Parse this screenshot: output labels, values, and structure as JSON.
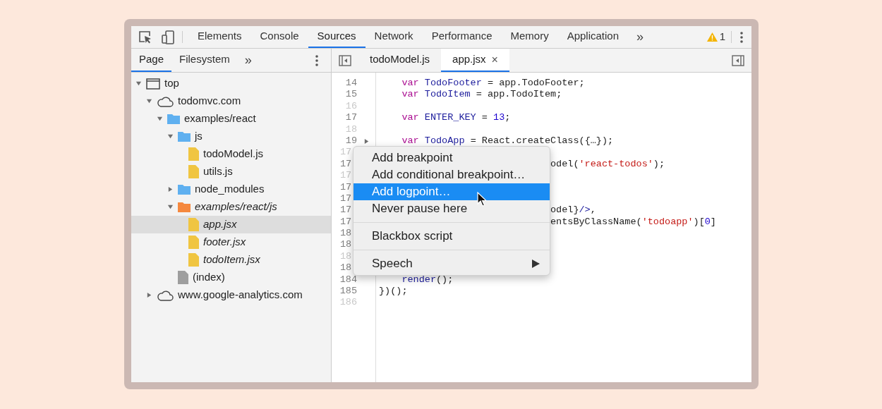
{
  "toolbar": {
    "tabs": [
      {
        "label": "Elements",
        "selected": false
      },
      {
        "label": "Console",
        "selected": false
      },
      {
        "label": "Sources",
        "selected": true
      },
      {
        "label": "Network",
        "selected": false
      },
      {
        "label": "Performance",
        "selected": false
      },
      {
        "label": "Memory",
        "selected": false
      },
      {
        "label": "Application",
        "selected": false
      }
    ],
    "more": "»",
    "warnings": "1"
  },
  "navigator": {
    "tabs": [
      {
        "label": "Page",
        "selected": true
      },
      {
        "label": "Filesystem",
        "selected": false
      }
    ],
    "more": "»",
    "tree": [
      {
        "label": "top",
        "kind": "frame",
        "expanded": true,
        "selected": false,
        "italic": false,
        "children": [
          {
            "label": "todomvc.com",
            "kind": "domain",
            "expanded": true,
            "selected": false,
            "italic": false,
            "children": [
              {
                "label": "examples/react",
                "kind": "folder",
                "color": "#5fb0f0",
                "expanded": true,
                "selected": false,
                "italic": false,
                "children": [
                  {
                    "label": "js",
                    "kind": "folder",
                    "color": "#5fb0f0",
                    "expanded": true,
                    "selected": false,
                    "italic": false,
                    "children": [
                      {
                        "label": "todoModel.js",
                        "kind": "file",
                        "color": "#f0c541",
                        "selected": false,
                        "italic": false
                      },
                      {
                        "label": "utils.js",
                        "kind": "file",
                        "color": "#f0c541",
                        "selected": false,
                        "italic": false
                      }
                    ]
                  },
                  {
                    "label": "node_modules",
                    "kind": "folder",
                    "color": "#5fb0f0",
                    "expanded": false,
                    "selected": false,
                    "italic": false
                  },
                  {
                    "label": "examples/react/js",
                    "kind": "folder",
                    "color": "#f5883e",
                    "expanded": true,
                    "selected": false,
                    "italic": true,
                    "children": [
                      {
                        "label": "app.jsx",
                        "kind": "file",
                        "color": "#f0c541",
                        "selected": true,
                        "italic": true
                      },
                      {
                        "label": "footer.jsx",
                        "kind": "file",
                        "color": "#f0c541",
                        "selected": false,
                        "italic": true
                      },
                      {
                        "label": "todoItem.jsx",
                        "kind": "file",
                        "color": "#f0c541",
                        "selected": false,
                        "italic": true
                      }
                    ]
                  },
                  {
                    "label": "(index)",
                    "kind": "file",
                    "color": "#9e9e9e",
                    "selected": false,
                    "italic": false
                  }
                ]
              }
            ]
          },
          {
            "label": "www.google-analytics.com",
            "kind": "domain",
            "expanded": false,
            "selected": false,
            "italic": false
          }
        ]
      }
    ]
  },
  "editor": {
    "tabs": [
      {
        "label": "todoModel.js",
        "selected": false,
        "closable": false
      },
      {
        "label": "app.jsx",
        "selected": true,
        "closable": true
      }
    ],
    "close": "×",
    "lines": [
      {
        "number": "14",
        "kind": "normal",
        "muted": false,
        "collapsed": false,
        "tokens": [
          {
            "text": "    var ",
            "kind": "keyword"
          },
          {
            "text": "TodoFooter",
            "kind": "variable"
          },
          {
            "text": " = app.TodoFooter;",
            "kind": "plain"
          }
        ]
      },
      {
        "number": "15",
        "kind": "normal",
        "muted": false,
        "collapsed": false,
        "tokens": [
          {
            "text": "    var ",
            "kind": "keyword"
          },
          {
            "text": "TodoItem",
            "kind": "variable"
          },
          {
            "text": " = app.TodoItem;",
            "kind": "plain"
          }
        ]
      },
      {
        "number": "16",
        "kind": "normal",
        "muted": true,
        "collapsed": false
      },
      {
        "number": "17",
        "kind": "normal",
        "muted": false,
        "collapsed": false,
        "tokens": [
          {
            "text": "    var ",
            "kind": "keyword"
          },
          {
            "text": "ENTER_KEY",
            "kind": "variable"
          },
          {
            "text": " = ",
            "kind": "plain"
          },
          {
            "text": "13",
            "kind": "number"
          },
          {
            "text": ";",
            "kind": "plain"
          }
        ]
      },
      {
        "number": "18",
        "kind": "normal",
        "muted": true,
        "collapsed": false
      },
      {
        "number": "19",
        "kind": "normal",
        "muted": false,
        "collapsed": true,
        "tokens": [
          {
            "text": "    var ",
            "kind": "keyword"
          },
          {
            "text": "TodoApp",
            "kind": "variable"
          },
          {
            "text": " = React.createClass({…});",
            "kind": "plain"
          }
        ]
      },
      {
        "number": "17",
        "kind": "covered",
        "muted": true
      },
      {
        "number": "17",
        "kind": "covered",
        "muted": false,
        "tokens": [
          {
            "text": "odel(",
            "kind": "plain"
          },
          {
            "text": "'react-todos'",
            "kind": "string"
          },
          {
            "text": ");",
            "kind": "plain"
          }
        ]
      },
      {
        "number": "17",
        "kind": "covered",
        "muted": true
      },
      {
        "number": "17",
        "kind": "covered",
        "muted": false
      },
      {
        "number": "17",
        "kind": "covered",
        "muted": false
      },
      {
        "number": "17",
        "kind": "covered",
        "muted": false,
        "tokens": [
          {
            "text": "odel}",
            "kind": "plain"
          },
          {
            "text": "/>",
            "kind": "variable"
          },
          {
            "text": ",",
            "kind": "plain"
          }
        ]
      },
      {
        "number": "17",
        "kind": "covered",
        "muted": false,
        "tokens": [
          {
            "text": "entsByClassName(",
            "kind": "plain"
          },
          {
            "text": "'todoapp'",
            "kind": "string"
          },
          {
            "text": ")[",
            "kind": "plain"
          },
          {
            "text": "0",
            "kind": "number"
          },
          {
            "text": "]",
            "kind": "plain"
          }
        ]
      },
      {
        "number": "18",
        "kind": "covered",
        "muted": false
      },
      {
        "number": "18",
        "kind": "covered",
        "muted": false
      },
      {
        "number": "18",
        "kind": "covered",
        "muted": true
      },
      {
        "number": "18",
        "kind": "covered",
        "muted": false
      },
      {
        "number": "184",
        "kind": "normal",
        "muted": false,
        "collapsed": false,
        "tokens": [
          {
            "text": "    render",
            "kind": "variable"
          },
          {
            "text": "();",
            "kind": "plain"
          }
        ]
      },
      {
        "number": "185",
        "kind": "normal",
        "muted": false,
        "collapsed": false,
        "tokens": [
          {
            "text": "})();",
            "kind": "plain"
          }
        ]
      },
      {
        "number": "186",
        "kind": "normal",
        "muted": true,
        "collapsed": false
      }
    ]
  },
  "context_menu": {
    "items": [
      {
        "kind": "item",
        "label": "Add breakpoint",
        "selected": false
      },
      {
        "kind": "item",
        "label": "Add conditional breakpoint…",
        "selected": false
      },
      {
        "kind": "item",
        "label": "Add logpoint…",
        "selected": true
      },
      {
        "kind": "item",
        "label": "Never pause here",
        "selected": false
      },
      {
        "kind": "separator"
      },
      {
        "kind": "item",
        "label": "Blackbox script",
        "selected": false
      },
      {
        "kind": "separator"
      },
      {
        "kind": "submenu",
        "label": "Speech",
        "selected": false
      }
    ]
  }
}
